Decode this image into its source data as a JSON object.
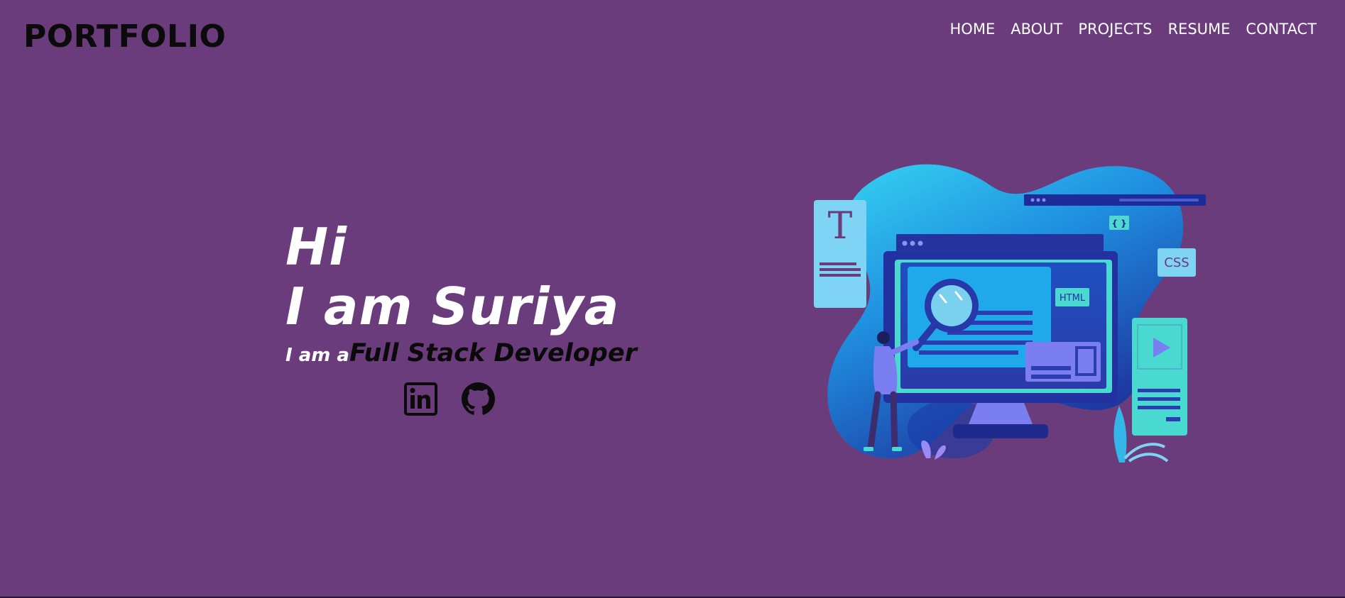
{
  "header": {
    "brand": "PORTFOLIO",
    "nav": [
      "HOME",
      "ABOUT",
      "PROJECTS",
      "RESUME",
      "CONTACT"
    ]
  },
  "hero": {
    "greeting": "Hi",
    "name_line": "I am Suriya",
    "role_prefix": "I am a",
    "role": "Full Stack Developer"
  },
  "socials": [
    {
      "icon": "linkedin-icon"
    },
    {
      "icon": "github-icon"
    }
  ],
  "illustration": {
    "html_label": "HTML",
    "css_label": "CSS",
    "t_label": "T",
    "braces_label": "{ }"
  },
  "colors": {
    "background": "#6a3c7b",
    "text_light": "#ffffff",
    "text_dark": "#0b0b0b"
  }
}
